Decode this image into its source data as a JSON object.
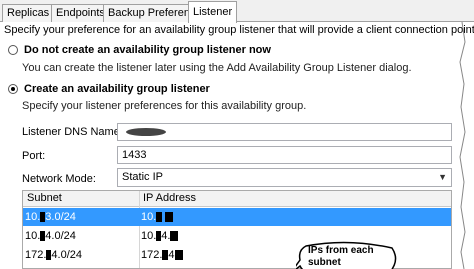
{
  "tabs": [
    {
      "label": "Replicas",
      "active": false
    },
    {
      "label": "Endpoints",
      "active": false
    },
    {
      "label": "Backup Preferences",
      "active": false
    },
    {
      "label": "Listener",
      "active": true
    }
  ],
  "description": "Specify your preference for an availability group listener that will provide a client connection point:",
  "options": {
    "no_listener": {
      "label": "Do not create an availability group listener now",
      "hint": "You can create the listener later using the Add Availability Group Listener dialog.",
      "selected": false
    },
    "create_listener": {
      "label": "Create an availability group listener",
      "hint": "Specify your listener preferences for this availability group.",
      "selected": true
    }
  },
  "form": {
    "dns_label": "Listener DNS Name:",
    "dns_value": "",
    "port_label": "Port:",
    "port_value": "1433",
    "mode_label": "Network Mode:",
    "mode_value": "Static IP"
  },
  "grid": {
    "columns": [
      "Subnet",
      "IP Address"
    ],
    "rows": [
      {
        "subnet_a": "10.",
        "subnet_b": "3.0/24",
        "ip": "10.",
        "selected": true
      },
      {
        "subnet_a": "10.",
        "subnet_b": "4.0/24",
        "ip": "10.",
        "ip_b": "4.",
        "selected": false
      },
      {
        "subnet_a": "172.",
        "subnet_b": "4.0/24",
        "ip": "172.",
        "ip_b": "4",
        "selected": false
      }
    ]
  },
  "callout": {
    "line1": "IPs from each",
    "line2": "subnet"
  },
  "colors": {
    "selection": "#3399ff",
    "tab_border": "#a0a0a0"
  }
}
